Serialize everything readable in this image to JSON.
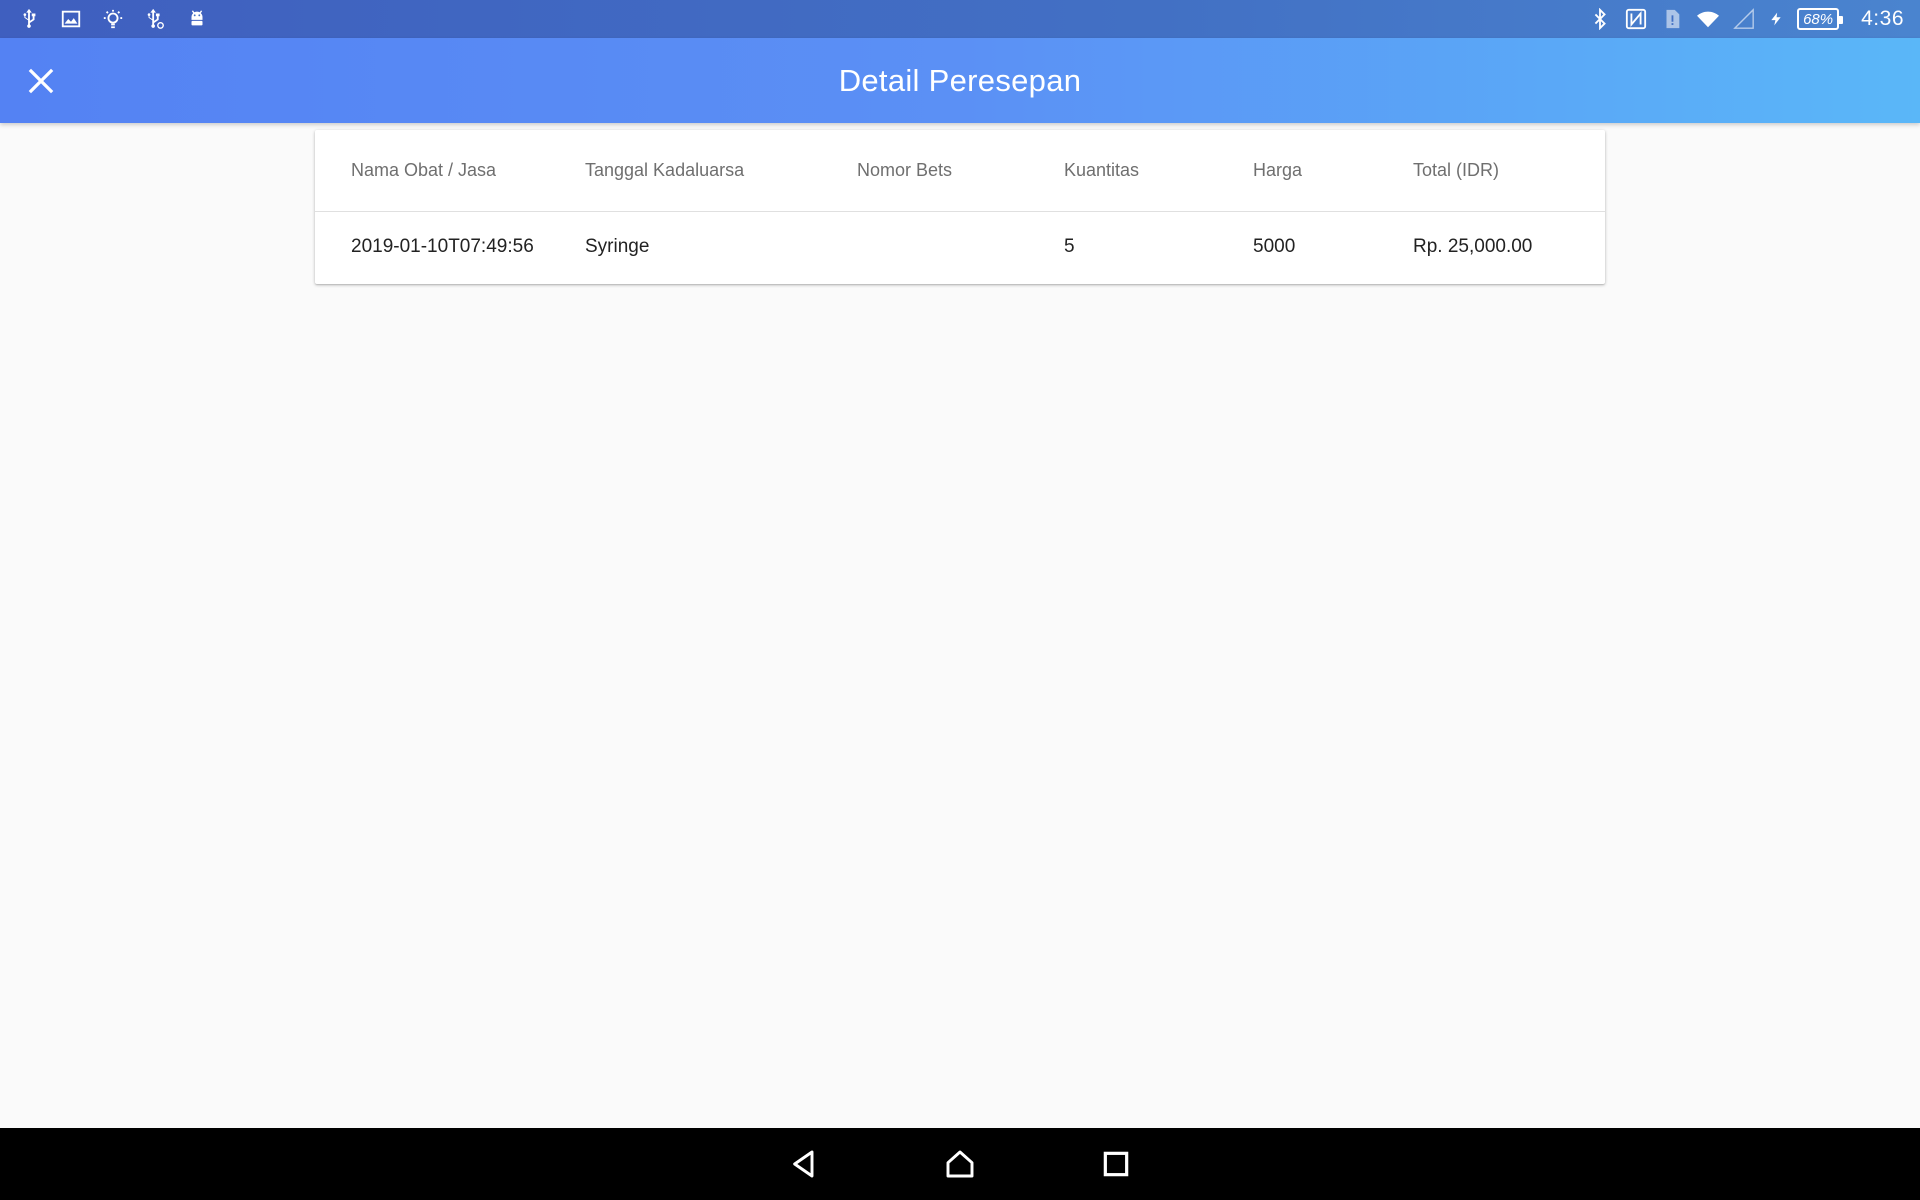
{
  "status_bar": {
    "left_icons": [
      "usb-icon",
      "image-icon",
      "lightbulb-icon",
      "usb-debug-icon",
      "android-icon"
    ],
    "right_icons": [
      "bluetooth-icon",
      "nfc-icon",
      "sim-alert-icon",
      "wifi-icon",
      "signal-icon",
      "charging-icon"
    ],
    "battery": "68%",
    "time": "4:36"
  },
  "app_bar": {
    "title": "Detail Peresepan",
    "close_icon": "close-icon"
  },
  "table": {
    "headers": [
      "Nama Obat / Jasa",
      "Tanggal Kadaluarsa",
      "Nomor Bets",
      "Kuantitas",
      "Harga",
      "Total (IDR)"
    ],
    "rows": [
      [
        "2019-01-10T07:49:56",
        "Syringe",
        "",
        "5",
        "5000",
        "Rp. 25,000.00"
      ]
    ]
  },
  "nav_bar": {
    "icons": [
      "back-icon",
      "home-icon",
      "recents-icon"
    ]
  },
  "colors": {
    "app_bar_start": "#5482f3",
    "app_bar_end": "#5ab7f8",
    "status_bar": "#4270c4",
    "background": "#fafafa"
  }
}
